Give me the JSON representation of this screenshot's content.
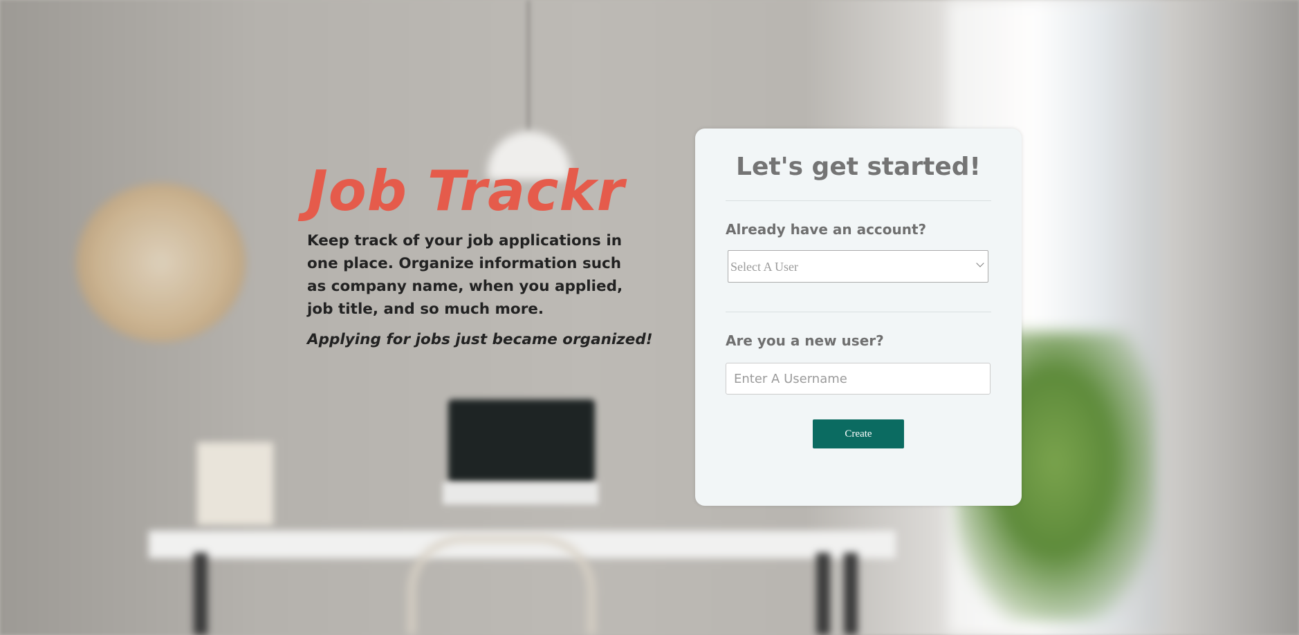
{
  "hero": {
    "brand": "Job Trackr",
    "description": "Keep track of your job applications in one place. Organize information such as company name, when you applied, job title, and so much more.",
    "tagline": "Applying for jobs just became organized!"
  },
  "card": {
    "title": "Let's get started!",
    "existing_label": "Already have an account?",
    "user_select": {
      "selected": "Select A User"
    },
    "new_label": "Are you a new user?",
    "username_placeholder": "Enter A Username",
    "create_label": "Create"
  },
  "colors": {
    "brand": "#e55b4b",
    "button": "#0b6b61",
    "card_bg": "#f2f6f7"
  }
}
